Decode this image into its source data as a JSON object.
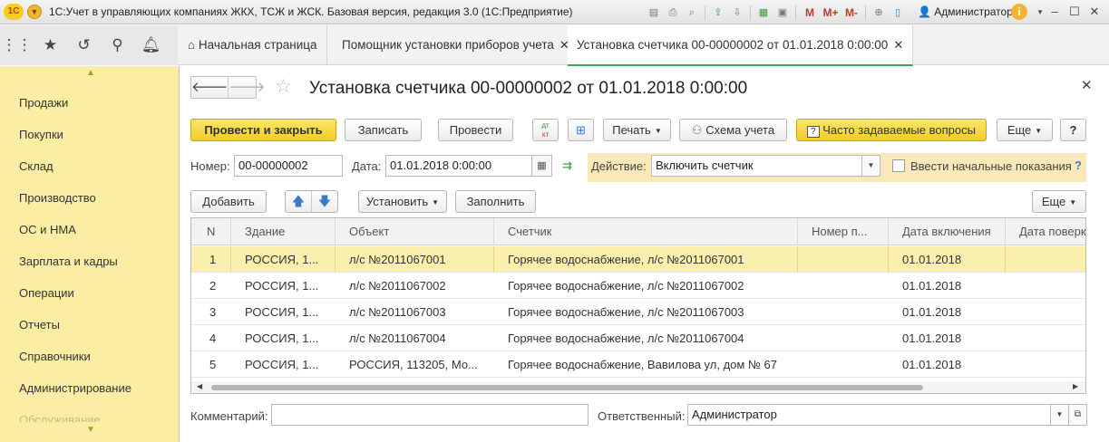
{
  "window": {
    "logo": "1С",
    "title": "1С:Учет в управляющих компаниях ЖКХ, ТСЖ и ЖСК. Базовая версия, редакция 3.0  (1С:Предприятие)",
    "user": "Администратор",
    "toolbar_icons": [
      "save-icon",
      "print-icon",
      "preview-icon",
      "upload-icon",
      "download-icon",
      "calculator-icon",
      "calendar-icon"
    ],
    "m_buttons": [
      "M",
      "M+",
      "M-"
    ]
  },
  "nav": {
    "tabs": [
      {
        "label": "Начальная страница"
      },
      {
        "label": "Помощник установки приборов учета"
      },
      {
        "label": "Установка счетчика 00-00000002 от 01.01.2018 0:00:00"
      }
    ]
  },
  "sidebar": {
    "items": [
      "Продажи",
      "Покупки",
      "Склад",
      "Производство",
      "ОС и НМА",
      "Зарплата и кадры",
      "Операции",
      "Отчеты",
      "Справочники",
      "Администрирование",
      "Обслуживание"
    ]
  },
  "form": {
    "title": "Установка счетчика 00-00000002 от 01.01.2018 0:00:00",
    "buttons": {
      "post_close": "Провести и закрыть",
      "save": "Записать",
      "post": "Провести",
      "dtkt_top": "дт",
      "dtkt_bottom": "кт",
      "print": "Печать",
      "scheme": "Схема учета",
      "faq": "Часто задаваемые вопросы",
      "more": "Еще",
      "help": "?"
    },
    "number_label": "Номер:",
    "number_value": "00-00000002",
    "date_label": "Дата:",
    "date_value": "01.01.2018  0:00:00",
    "action_label": "Действие:",
    "action_value": "Включить счетчик",
    "initial_readings_label": "Ввести начальные показания",
    "initial_readings_checked": false,
    "table_buttons": {
      "add": "Добавить",
      "set": "Установить",
      "fill": "Заполнить",
      "more": "Еще"
    },
    "columns": [
      "N",
      "Здание",
      "Объект",
      "Счетчик",
      "Номер п...",
      "Дата включения",
      "Дата поверк"
    ],
    "rows": [
      {
        "n": "1",
        "building": "РОССИЯ, 1...",
        "object": "л/с №2011067001",
        "meter": "Горячее водоснабжение, л/с №2011067001",
        "num": "",
        "date_on": "01.01.2018",
        "date_check": ""
      },
      {
        "n": "2",
        "building": "РОССИЯ, 1...",
        "object": "л/с №2011067002",
        "meter": "Горячее водоснабжение, л/с №2011067002",
        "num": "",
        "date_on": "01.01.2018",
        "date_check": ""
      },
      {
        "n": "3",
        "building": "РОССИЯ, 1...",
        "object": "л/с №2011067003",
        "meter": "Горячее водоснабжение, л/с №2011067003",
        "num": "",
        "date_on": "01.01.2018",
        "date_check": ""
      },
      {
        "n": "4",
        "building": "РОССИЯ, 1...",
        "object": "л/с №2011067004",
        "meter": "Горячее водоснабжение, л/с №2011067004",
        "num": "",
        "date_on": "01.01.2018",
        "date_check": ""
      },
      {
        "n": "5",
        "building": "РОССИЯ, 1...",
        "object": "РОССИЯ, 113205, Мо...",
        "meter": "Горячее водоснабжение, Вавилова ул, дом № 67",
        "num": "",
        "date_on": "01.01.2018",
        "date_check": ""
      }
    ],
    "comment_label": "Комментарий:",
    "comment_value": "",
    "responsible_label": "Ответственный:",
    "responsible_value": "Администратор"
  }
}
